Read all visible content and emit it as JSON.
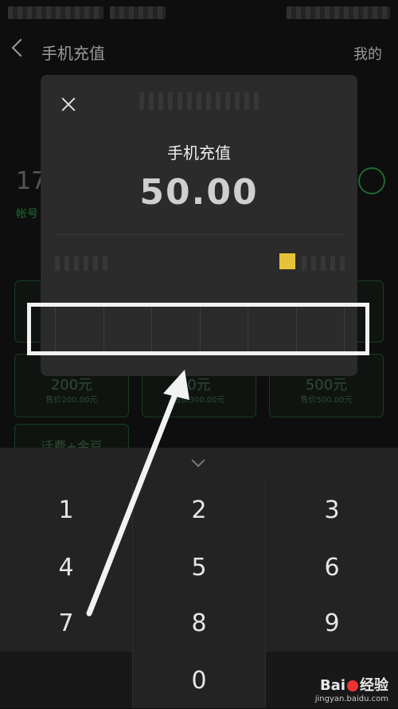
{
  "nav": {
    "title": "手机充值",
    "right_label": "我的"
  },
  "background": {
    "phone_prefix": "17",
    "account_label": "帐号",
    "tiles": [
      {
        "value": "200元",
        "sub": "售价200.00元"
      },
      {
        "value": "0元",
        "sub": "售价300.00元"
      },
      {
        "value": "500元",
        "sub": "售价500.00元"
      }
    ],
    "bottom_tile_label": "话费+金豆"
  },
  "dialog": {
    "title": "手机充值",
    "amount": "50.00",
    "pin_cells": 6
  },
  "keypad": {
    "keys": [
      "1",
      "2",
      "3",
      "4",
      "5",
      "6",
      "7",
      "8",
      "9",
      "0"
    ]
  },
  "watermark": {
    "logo_left": "Bai",
    "logo_right": "经验",
    "url": "jingyan.baidu.com"
  }
}
